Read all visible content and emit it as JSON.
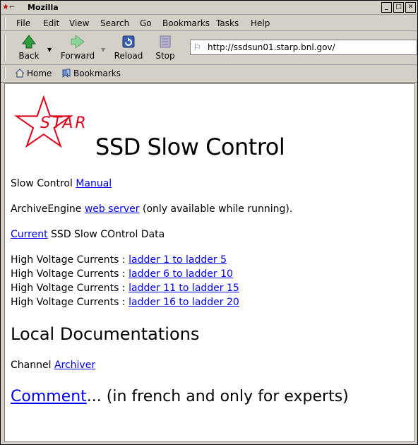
{
  "window": {
    "title": "Mozilla"
  },
  "menu": [
    "File",
    "Edit",
    "View",
    "Search",
    "Go",
    "Bookmarks",
    "Tasks",
    "Help"
  ],
  "toolbar": {
    "back": "Back",
    "forward": "Forward",
    "reload": "Reload",
    "stop": "Stop"
  },
  "address": {
    "url": "http://ssdsun01.starp.bnl.gov/"
  },
  "personal_toolbar": {
    "home": "Home",
    "bookmarks": "Bookmarks"
  },
  "page": {
    "logo_text": "STAR",
    "title": "SSD Slow Control",
    "slow_control": {
      "prefix": "Slow Control ",
      "link": "Manual"
    },
    "archive_engine": {
      "prefix": "ArchiveEngine ",
      "link": "web server",
      "suffix": " (only available while running)."
    },
    "current": {
      "link": "Current",
      "suffix": " SSD Slow COntrol Data"
    },
    "hv": [
      {
        "prefix": "High Voltage Currents : ",
        "link": "ladder 1 to ladder 5"
      },
      {
        "prefix": "High Voltage Currents : ",
        "link": "ladder 6 to ladder 10"
      },
      {
        "prefix": "High Voltage Currents : ",
        "link": "ladder 11 to ladder 15"
      },
      {
        "prefix": "High Voltage Currents : ",
        "link": "ladder 16 to ladder 20"
      }
    ],
    "local_docs": "Local Documentations",
    "channel": {
      "prefix": "Channel ",
      "link": "Archiver"
    },
    "comment": {
      "link": "Comment",
      "suffix": "... (in french and only for experts)"
    }
  },
  "colors": {
    "link": "#0000ee",
    "logo": "#e0001a"
  }
}
